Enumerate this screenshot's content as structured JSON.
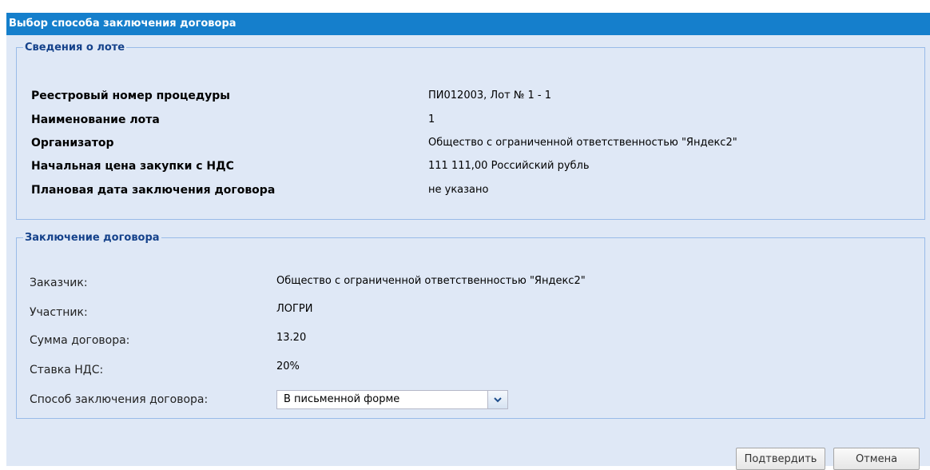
{
  "window": {
    "title": "Выбор способа заключения договора"
  },
  "lot_section": {
    "legend": "Сведения о лоте",
    "rows": [
      {
        "label": "Реестровый номер процедуры",
        "value": "ПИ012003, Лот № 1 - 1"
      },
      {
        "label": "Наименование лота",
        "value": "1"
      },
      {
        "label": "Организатор",
        "value": "Общество с ограниченной ответственностью \"Яндекс2\""
      },
      {
        "label": "Начальная цена закупки с НДС",
        "value": "111 111,00 Российский рубль"
      },
      {
        "label": "Плановая дата заключения договора",
        "value": "не указано"
      }
    ]
  },
  "contract_section": {
    "legend": "Заключение договора",
    "rows": [
      {
        "label": "Заказчик:",
        "value": "Общество с ограниченной ответственностью \"Яндекс2\""
      },
      {
        "label": "Участник:",
        "value": "ЛОГРИ"
      },
      {
        "label": "Сумма договора:",
        "value": "13.20"
      },
      {
        "label": "Ставка НДС:",
        "value": "20%"
      }
    ],
    "method": {
      "label": "Способ заключения договора:",
      "selected": "В письменной форме"
    }
  },
  "buttons": {
    "confirm": "Подтвердить",
    "cancel": "Отмена"
  },
  "colors": {
    "titlebar": "#157fcc",
    "panel_bg": "#dfe8f6",
    "legend_text": "#15428b",
    "fieldset_border": "#99bbe8"
  },
  "icons": {
    "dropdown": "chevron-down-icon"
  }
}
